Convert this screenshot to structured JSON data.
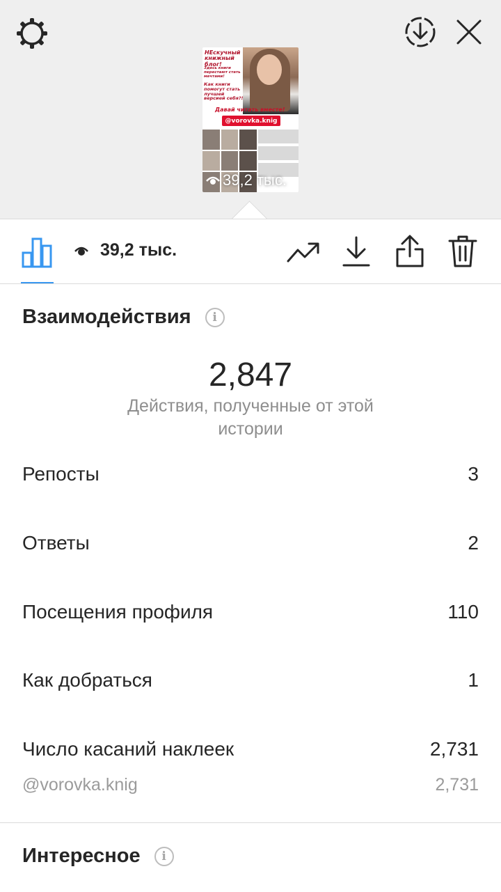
{
  "story_preview": {
    "views_overlay": "39,2 тыс.",
    "thumb_title": "НЕскучный книжный блог!",
    "thumb_line1": "Здесь книги перестают стать мечтами!",
    "thumb_line2": "Как книги помогут стать лучшей версией себя?!",
    "thumb_cta": "Давай читать вместе!",
    "thumb_tag": "@vorovka.knig"
  },
  "toolbar": {
    "views": "39,2 тыс."
  },
  "interactions": {
    "title": "Взаимодействия",
    "info": "i",
    "total": "2,847",
    "caption": "Действия, полученные от этой истории",
    "rows": [
      {
        "label": "Репосты",
        "value": "3"
      },
      {
        "label": "Ответы",
        "value": "2"
      },
      {
        "label": "Посещения профиля",
        "value": "110"
      },
      {
        "label": "Как добраться",
        "value": "1"
      },
      {
        "label": "Число касаний наклеек",
        "value": "2,731"
      }
    ],
    "sticker": {
      "label": "@vorovka.knig",
      "value": "2,731"
    }
  },
  "discovery": {
    "title": "Интересное",
    "info": "i"
  },
  "colors": {
    "accent": "#3897f0",
    "text": "#262626",
    "muted": "#8e8e8e",
    "divider": "#dbdbdb",
    "top_bg": "#efefef"
  },
  "icons": [
    "gear-icon",
    "download-circle-icon",
    "close-icon",
    "bar-chart-icon",
    "eye-icon",
    "trending-icon",
    "download-icon",
    "share-icon",
    "trash-icon",
    "info-icon"
  ]
}
